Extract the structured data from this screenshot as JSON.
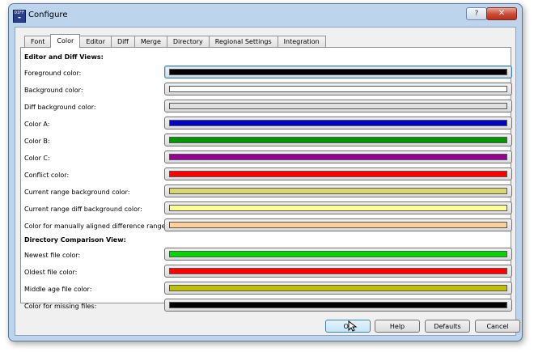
{
  "window": {
    "title": "Configure",
    "app_icon": "Diff-app-icon",
    "help_glyph": "?",
    "close_glyph": "✕"
  },
  "tabs": [
    {
      "label": "Font",
      "active": false
    },
    {
      "label": "Color",
      "active": true
    },
    {
      "label": "Editor",
      "active": false
    },
    {
      "label": "Diff",
      "active": false
    },
    {
      "label": "Merge",
      "active": false
    },
    {
      "label": "Directory",
      "active": false
    },
    {
      "label": "Regional Settings",
      "active": false
    },
    {
      "label": "Integration",
      "active": false
    }
  ],
  "sections": {
    "editor_heading": "Editor and Diff Views:",
    "directory_heading": "Directory Comparison View:"
  },
  "colors": [
    {
      "label": "Foreground color:",
      "color": "#000000"
    },
    {
      "label": "Background color:",
      "color": "#ffffff"
    },
    {
      "label": "Diff background color:",
      "color": "#e0e0e0"
    },
    {
      "label": "Color A:",
      "color": "#0000c8"
    },
    {
      "label": "Color B:",
      "color": "#009600"
    },
    {
      "label": "Color C:",
      "color": "#960096"
    },
    {
      "label": "Conflict color:",
      "color": "#ff0000"
    },
    {
      "label": "Current range background color:",
      "color": "#d8d870"
    },
    {
      "label": "Current range diff background color:",
      "color": "#ffff98"
    },
    {
      "label": "Color for manually aligned difference ranges:",
      "color": "#ffd098"
    },
    {
      "label": "Newest file color:",
      "color": "#00d800"
    },
    {
      "label": "Oldest file color:",
      "color": "#ff0000"
    },
    {
      "label": "Middle age file color:",
      "color": "#c0c000"
    },
    {
      "label": "Color for missing files:",
      "color": "#000000"
    }
  ],
  "buttons": {
    "ok": "Ok",
    "help": "Help",
    "defaults": "Defaults",
    "cancel": "Cancel"
  }
}
